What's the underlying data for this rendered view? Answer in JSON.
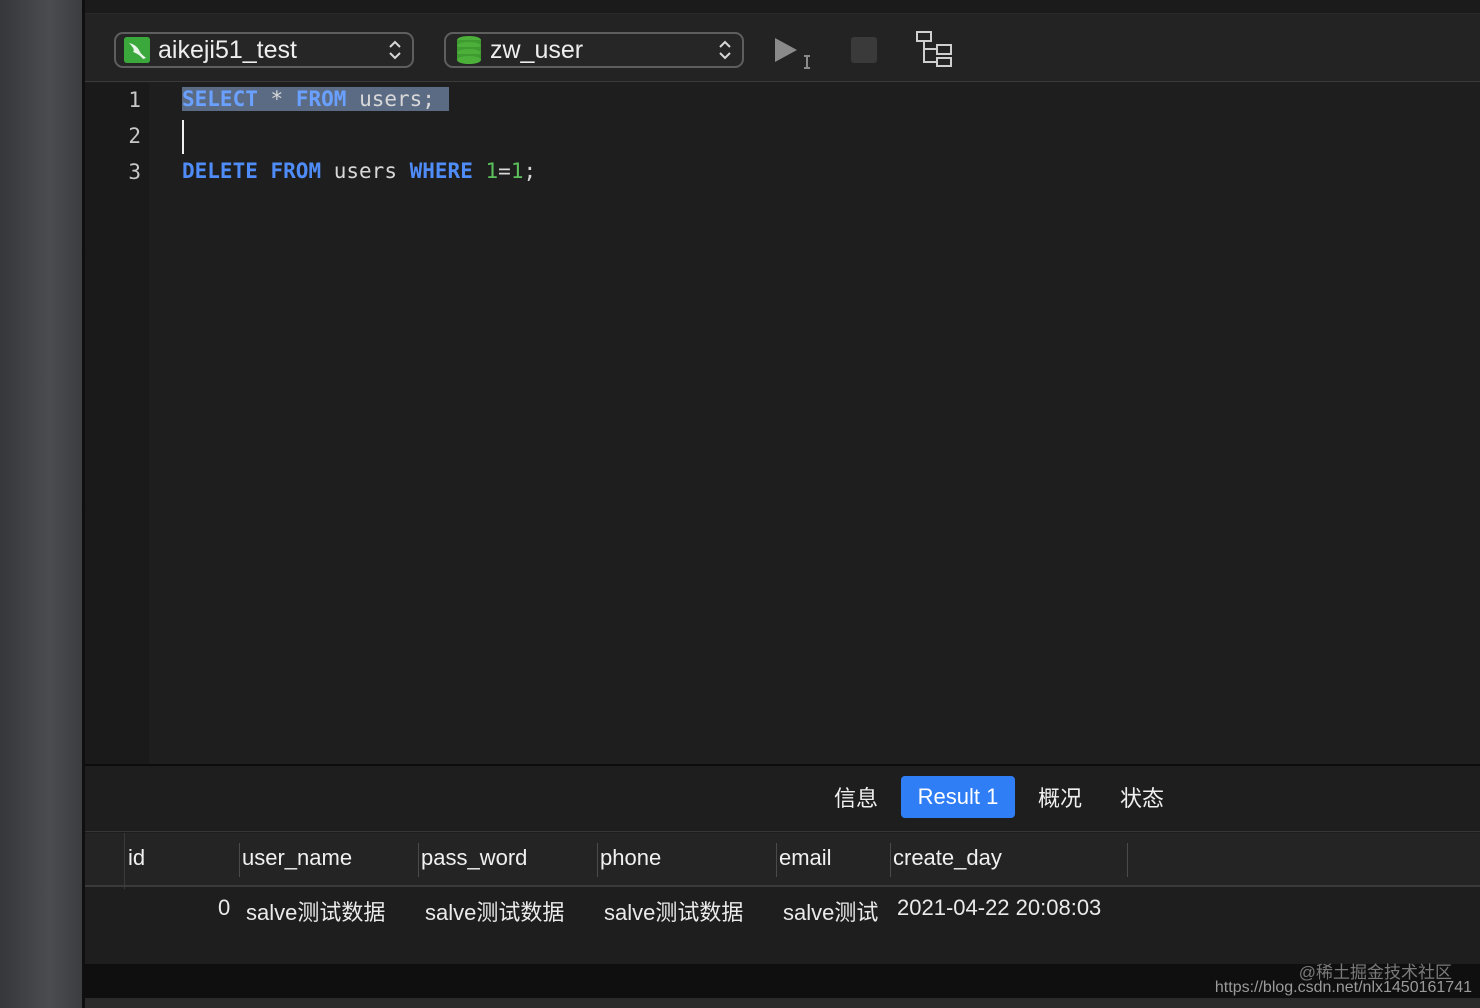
{
  "toolbar": {
    "connection": "aikeji51_test",
    "database": "zw_user",
    "connection_icon": "mysql-icon",
    "database_icon": "database-icon"
  },
  "editor": {
    "line_numbers": [
      "1",
      "2",
      "3"
    ],
    "line1": {
      "kw1": "SELECT",
      "star": "*",
      "kw2": "FROM",
      "table": "users;"
    },
    "line3": {
      "kw1": "DELETE",
      "kw2": "FROM",
      "table": "users",
      "kw3": "WHERE",
      "n1": "1",
      "eq": "=",
      "n2": "1",
      "semi": ";"
    }
  },
  "result_tabs": [
    {
      "label": "信息"
    },
    {
      "label": "Result 1",
      "active": true
    },
    {
      "label": "概况"
    },
    {
      "label": "状态"
    }
  ],
  "grid": {
    "columns": [
      "id",
      "user_name",
      "pass_word",
      "phone",
      "email",
      "create_day"
    ],
    "rows": [
      [
        "0",
        "salve测试数据",
        "salve测试数据",
        "salve测试数据",
        "salve测试",
        "2021-04-22 20:08:03"
      ]
    ]
  },
  "watermark": {
    "line1": "@稀土掘金技术社区",
    "line2": "https://blog.csdn.net/nlx1450161741"
  },
  "colors": {
    "keyword": "#4f8cf7",
    "number": "#5cc15c",
    "active_tab": "#2f7ef6",
    "selection": "#5b6b84"
  }
}
